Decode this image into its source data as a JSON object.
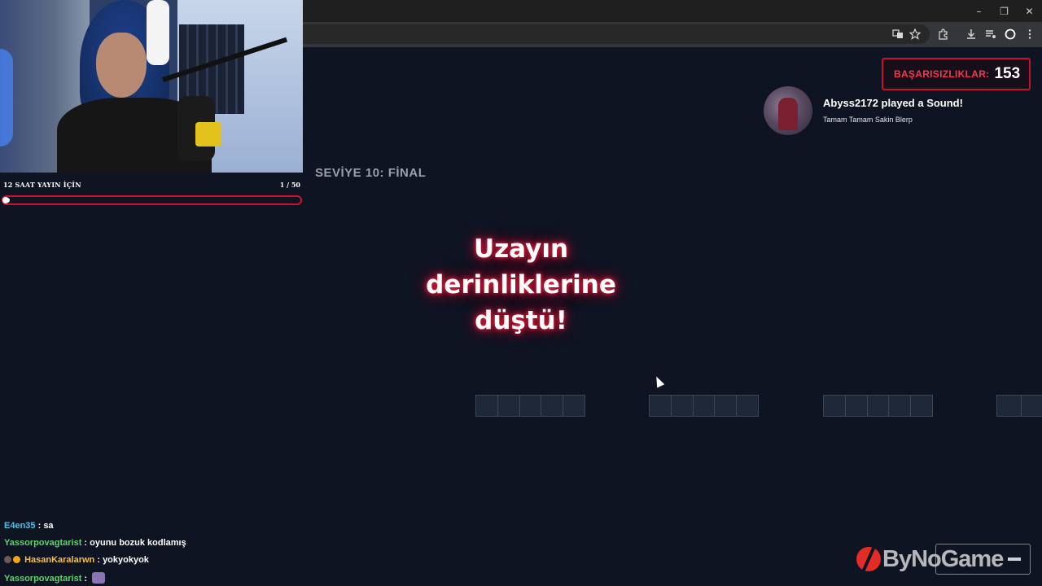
{
  "browser": {
    "window_controls": {
      "minimize": "–",
      "restore": "❐",
      "close": "✕"
    },
    "toolbar_icons": [
      "translate-icon",
      "star-icon",
      "extensions-icon",
      "download-icon",
      "media-icon",
      "profile-icon",
      "menu-icon"
    ]
  },
  "stream_goal": {
    "label": "12 SAAT YAYIN İÇİN",
    "count": "1 / 50",
    "progress": 0.02,
    "color": "#d1112d"
  },
  "game": {
    "level_title": "SEVİYE 10: FİNAL",
    "death_message": [
      "Uzayın",
      "derinliklerine",
      "düştü!"
    ],
    "platforms": [
      5,
      5,
      5,
      2
    ]
  },
  "fail_counter": {
    "label": "BAŞARISIZLIKLAR:",
    "value": "153",
    "color": "#c91028"
  },
  "alert": {
    "title": "Abyss2172 played a Sound!",
    "subtitle": "Tamam Tamam Sakin Blerp"
  },
  "chat": [
    {
      "user": "E4en35",
      "message": "sa",
      "user_color": "blue"
    },
    {
      "user": "Yassorpovagtarist",
      "message": "oyunu bozuk kodlamış",
      "user_color": "green"
    },
    {
      "user": "HasanKaralarwn",
      "message": "yokyokyok",
      "user_color": "gold",
      "badges": true
    },
    {
      "user": "Yassorpovagtarist",
      "message": "",
      "user_color": "green",
      "emote": true
    }
  ],
  "watermark": {
    "text": "ByNoGame"
  }
}
